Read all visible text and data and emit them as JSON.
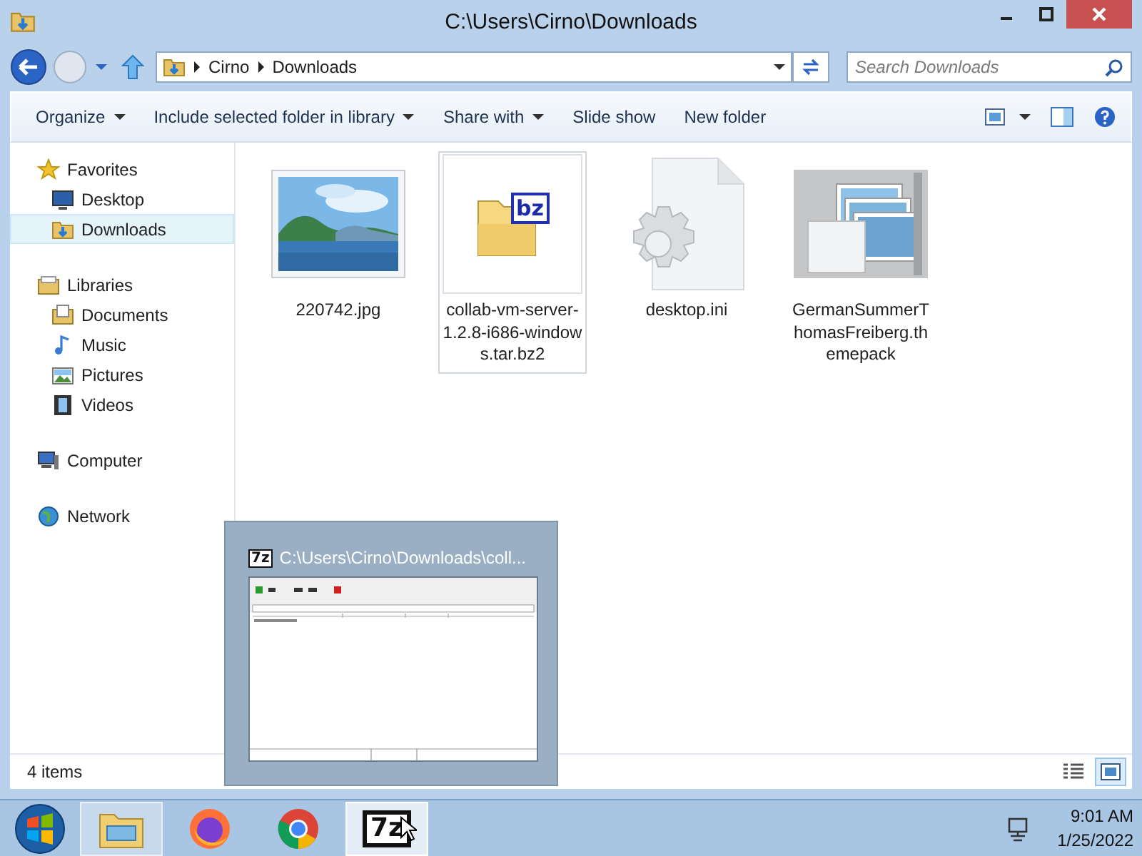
{
  "window": {
    "title": "C:\\Users\\Cirno\\Downloads"
  },
  "navigation": {
    "breadcrumbs": [
      "Cirno",
      "Downloads"
    ],
    "search": {
      "placeholder": "Search Downloads"
    }
  },
  "toolbar": {
    "commands": [
      {
        "label": "Organize",
        "dropdown": true
      },
      {
        "label": "Include selected folder in library",
        "dropdown": true
      },
      {
        "label": "Share with",
        "dropdown": true
      },
      {
        "label": "Slide show",
        "dropdown": false
      },
      {
        "label": "New folder",
        "dropdown": false
      }
    ]
  },
  "sidebar": {
    "groups": [
      {
        "label": "Favorites",
        "kind": "star",
        "selected": false,
        "children": [
          {
            "label": "Desktop",
            "kind": "desktop",
            "selected": false
          },
          {
            "label": "Downloads",
            "kind": "downloads",
            "selected": true
          }
        ]
      },
      {
        "label": "Libraries",
        "kind": "library",
        "selected": false,
        "children": [
          {
            "label": "Documents",
            "kind": "documents",
            "selected": false
          },
          {
            "label": "Music",
            "kind": "music",
            "selected": false
          },
          {
            "label": "Pictures",
            "kind": "pictures",
            "selected": false
          },
          {
            "label": "Videos",
            "kind": "videos",
            "selected": false
          }
        ]
      },
      {
        "label": "Computer",
        "kind": "computer",
        "selected": false
      },
      {
        "label": "Network",
        "kind": "network",
        "selected": false
      }
    ]
  },
  "files": [
    {
      "name": "220742.jpg",
      "selected": false
    },
    {
      "name": "collab-vm-server-1.2.8-i686-windows.tar.bz2",
      "kind": "archive",
      "badge": "bz",
      "selected": true
    },
    {
      "name": "desktop.ini",
      "kind": "settings",
      "selected": false
    },
    {
      "name": "GermanSummerThomasFreiberg.themepack",
      "kind": "themepack",
      "selected": false
    }
  ],
  "status_bar": {
    "item_count": "4 items",
    "views": [
      {
        "kind": "details",
        "selected": false
      },
      {
        "kind": "large-icons",
        "selected": true
      }
    ]
  },
  "preview": {
    "badge": "7z",
    "title": "C:\\Users\\Cirno\\Downloads\\coll..."
  },
  "taskbar": {
    "items": [
      {
        "kind": "explorer",
        "running": true,
        "hovered": false
      },
      {
        "kind": "firefox",
        "running": false,
        "hovered": false
      },
      {
        "kind": "chrome",
        "running": false,
        "hovered": false
      },
      {
        "kind": "archiver",
        "badge": "7z",
        "running": true,
        "hovered": true
      }
    ],
    "clock": {
      "time": "9:01 AM",
      "date": "1/25/2022"
    }
  }
}
